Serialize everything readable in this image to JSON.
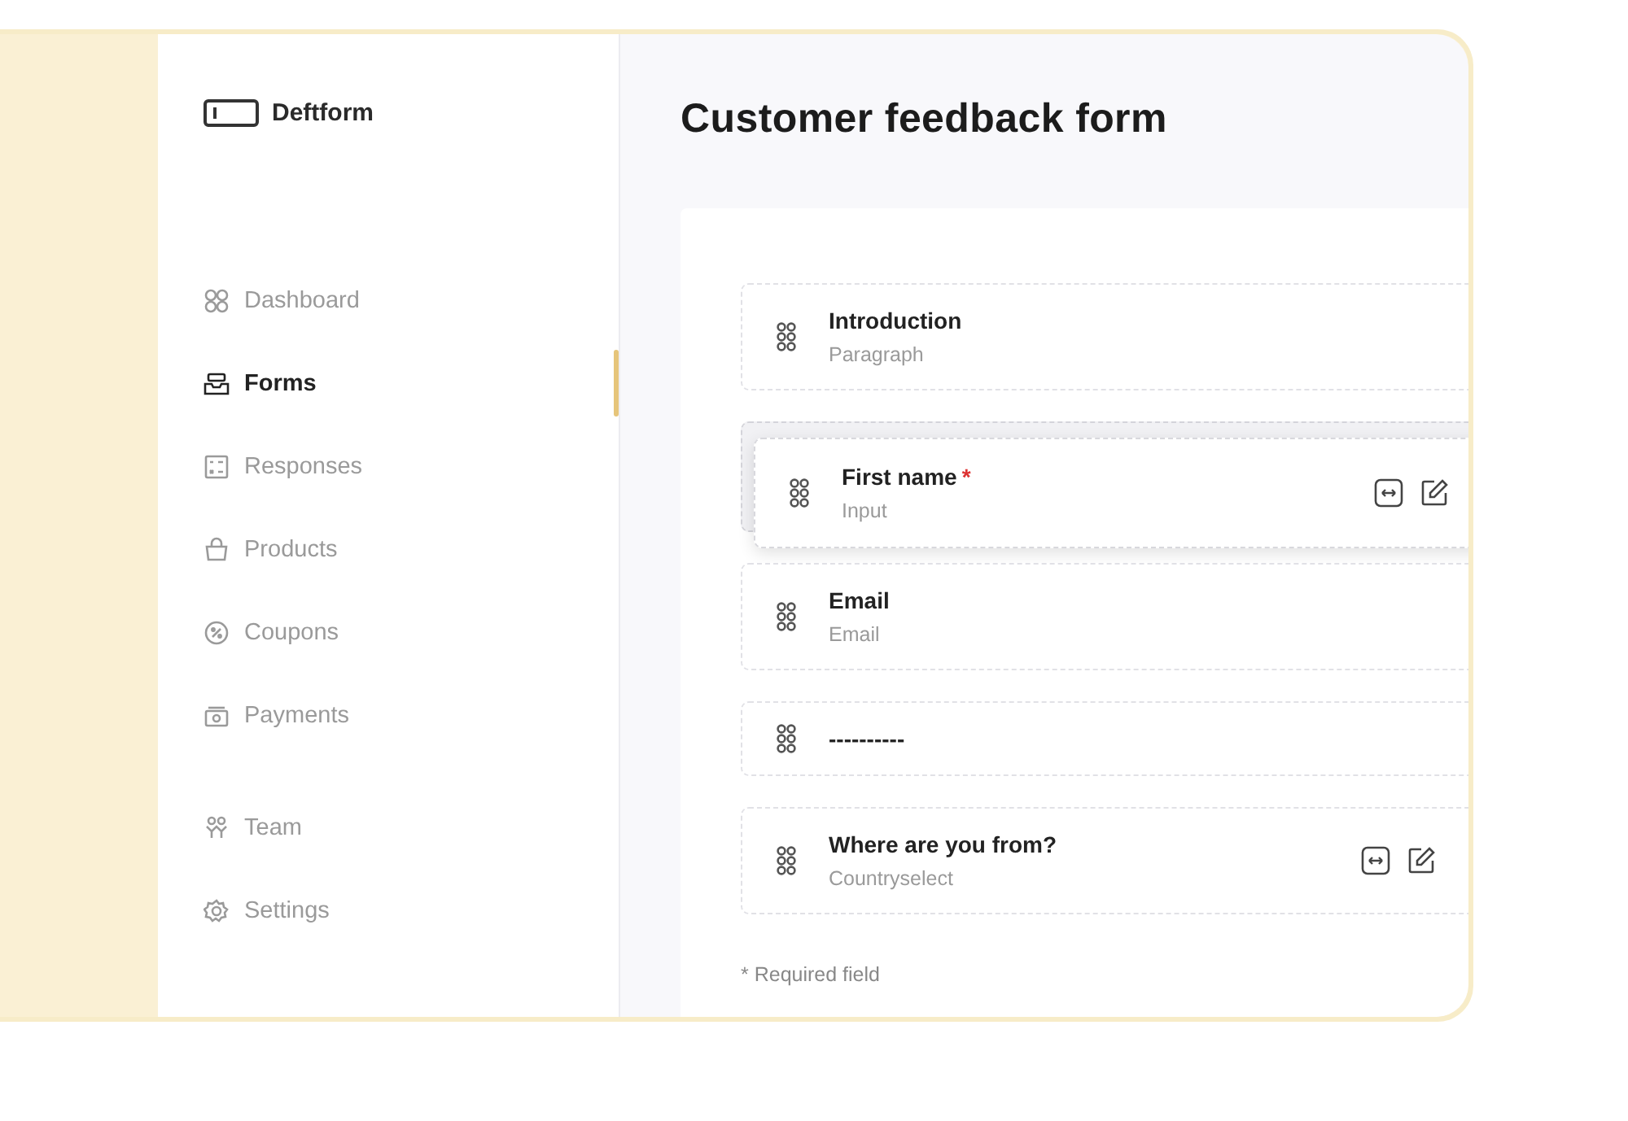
{
  "brand": {
    "name": "Deftform"
  },
  "nav": [
    {
      "label": "Dashboard",
      "selected": false
    },
    {
      "label": "Forms",
      "selected": true
    },
    {
      "label": "Responses",
      "selected": false
    },
    {
      "label": "Products",
      "selected": false
    },
    {
      "label": "Coupons",
      "selected": false
    },
    {
      "label": "Payments",
      "selected": false
    },
    {
      "label": "Team",
      "selected": false
    },
    {
      "label": "Settings",
      "selected": false
    }
  ],
  "page_title": "Customer feedback form",
  "fields": [
    {
      "kind": "field",
      "title": "Introduction",
      "type": "Paragraph",
      "dragging": false,
      "actions": false
    },
    {
      "kind": "field",
      "title": "First name",
      "required_mark": "*",
      "type": "Input",
      "dragging": true,
      "actions": true
    },
    {
      "kind": "field",
      "title": "Email",
      "type": "Email",
      "dragging": false,
      "actions": false
    },
    {
      "kind": "divider",
      "title": "----------",
      "dragging": false,
      "actions": false
    },
    {
      "kind": "field",
      "title": "Where are you from?",
      "type": "Countryselect",
      "dragging": false,
      "actions": true
    }
  ],
  "footnote": "* Required field"
}
